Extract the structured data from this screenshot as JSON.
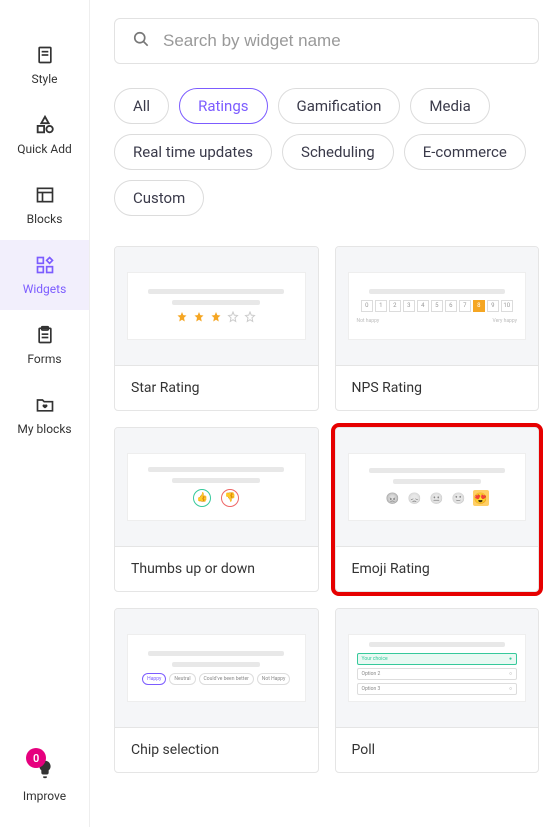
{
  "sidebar": {
    "items": [
      {
        "label": "Style"
      },
      {
        "label": "Quick Add"
      },
      {
        "label": "Blocks"
      },
      {
        "label": "Widgets"
      },
      {
        "label": "Forms"
      },
      {
        "label": "My blocks"
      }
    ],
    "improve": {
      "label": "Improve",
      "badge": "0"
    }
  },
  "search": {
    "placeholder": "Search by widget name"
  },
  "filters": [
    {
      "label": "All"
    },
    {
      "label": "Ratings",
      "active": true
    },
    {
      "label": "Gamification"
    },
    {
      "label": "Media"
    },
    {
      "label": "Real time updates"
    },
    {
      "label": "Scheduling"
    },
    {
      "label": "E-commerce"
    },
    {
      "label": "Custom"
    }
  ],
  "widgets": [
    {
      "label": "Star Rating"
    },
    {
      "label": "NPS Rating"
    },
    {
      "label": "Thumbs up or down"
    },
    {
      "label": "Emoji Rating",
      "highlighted": true
    },
    {
      "label": "Chip selection"
    },
    {
      "label": "Poll"
    }
  ],
  "nps": {
    "low": "Not happy",
    "high": "Very happy"
  },
  "chips": [
    "Happy",
    "Neutral",
    "Could've been better",
    "Not Happy"
  ],
  "poll": [
    "Your choice",
    "Option 2",
    "Option 3"
  ]
}
